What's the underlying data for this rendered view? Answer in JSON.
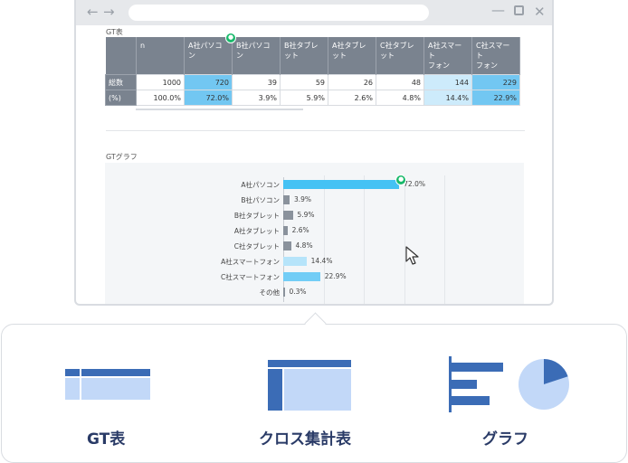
{
  "browser": {
    "back_icon": "arrow-left-icon",
    "forward_icon": "arrow-right-icon",
    "minimize_icon": "minimize-icon",
    "maximize_icon": "maximize-icon",
    "close_icon": "close-icon"
  },
  "gt_section": {
    "label": "GT表",
    "columns": [
      "n",
      "A社パソコン",
      "B社パソコン",
      "B社タブレット",
      "A社タブレット",
      "C社タブレット",
      "A社スマートフォン",
      "C社スマートフォン"
    ],
    "column_lines": [
      [
        "n"
      ],
      [
        "A社パソコン"
      ],
      [
        "B社パソコン"
      ],
      [
        "B社タブレット"
      ],
      [
        "A社タブレット"
      ],
      [
        "C社タブレット"
      ],
      [
        "A社スマート",
        "フォン"
      ],
      [
        "C社スマート",
        "フォン"
      ]
    ],
    "rows": [
      {
        "label": "総数",
        "values": [
          "1000",
          "720",
          "39",
          "59",
          "26",
          "48",
          "144",
          "229"
        ]
      },
      {
        "label": "(%)",
        "values": [
          "100.0%",
          "72.0%",
          "3.9%",
          "5.9%",
          "2.6%",
          "4.8%",
          "14.4%",
          "22.9%"
        ]
      }
    ]
  },
  "graph_section": {
    "label": "GTグラフ"
  },
  "chart_data": {
    "type": "bar",
    "orientation": "horizontal",
    "categories": [
      "A社パソコン",
      "B社パソコン",
      "B社タブレット",
      "A社タブレット",
      "C社タブレット",
      "A社スマートフォン",
      "C社スマートフォン",
      "その他"
    ],
    "values": [
      72.0,
      3.9,
      5.9,
      2.6,
      4.8,
      14.4,
      22.9,
      0.3
    ],
    "value_labels": [
      "72.0%",
      "3.9%",
      "5.9%",
      "2.6%",
      "4.8%",
      "14.4%",
      "22.9%",
      "0.3%"
    ],
    "colors": [
      "#45c2f4",
      "#8a929c",
      "#8a929c",
      "#8a929c",
      "#8a929c",
      "#b6e4fa",
      "#72cdf6",
      "#8a929c"
    ],
    "xlim": [
      0,
      100
    ],
    "grid": true
  },
  "options": [
    {
      "label": "GT表",
      "icon": "gt-table-icon"
    },
    {
      "label": "クロス集計表",
      "icon": "cross-tab-icon"
    },
    {
      "label": "グラフ",
      "icon": "graph-icon"
    }
  ],
  "colors": {
    "accent_dark": "#3b6cb6",
    "accent_light": "#c2d8f8",
    "badge": "#19b96b",
    "header_gray": "#7a838f"
  }
}
